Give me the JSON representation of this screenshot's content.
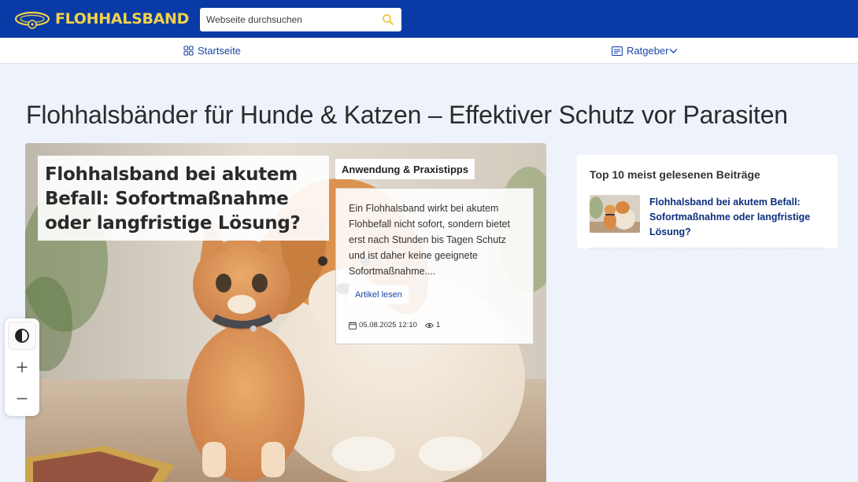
{
  "header": {
    "logo_text": "FLOHHALSBAND",
    "search_placeholder": "Webseite durchsuchen"
  },
  "nav": {
    "home_label": "Startseite",
    "guide_label": "Ratgeber"
  },
  "page": {
    "title": "Flohhalsbänder für Hunde & Katzen – Effektiver Schutz vor Parasiten"
  },
  "featured": {
    "title": "Flohhalsband bei akutem Befall: Sofortmaßnahme oder langfristige Lösung?",
    "category": "Anwendung & Praxistipps",
    "excerpt": "Ein Flohhalsband wirkt bei akutem Flohbefall nicht sofort, sondern bietet erst nach Stunden bis Tagen Schutz und ist daher keine geeignete Sofortmaßnahme....",
    "read_more": "Artikel lesen",
    "date": "05.08.2025 12:10",
    "views": "1"
  },
  "sidebar": {
    "top10_title": "Top 10 meist gelesenen Beiträge",
    "items": [
      {
        "title": "Flohhalsband bei akutem Befall: Sofortmaßnahme oder langfristige Lösung?"
      }
    ]
  },
  "colors": {
    "header_bg": "#0a3aa6",
    "logo_yellow": "#f2d24a",
    "link_blue": "#1a46a8",
    "page_bg": "#eef2fb"
  },
  "icons": {
    "logo": "collar-icon",
    "search": "search-icon",
    "home": "grid-icon",
    "guide": "list-icon",
    "chevron": "chevron-down-icon",
    "calendar": "calendar-icon",
    "views": "eye-icon",
    "contrast": "contrast-icon",
    "zoom_in": "plus-icon",
    "zoom_out": "minus-icon"
  }
}
